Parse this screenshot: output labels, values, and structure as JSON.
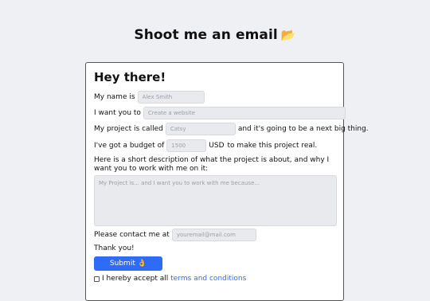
{
  "page": {
    "title": "Shoot me an email",
    "title_emoji": "📂"
  },
  "form": {
    "heading": "Hey there!",
    "name_label": "My name is",
    "name_placeholder": "Alex Smith",
    "want_label": "I want you to",
    "want_placeholder": "Create a website",
    "project_label": "My project is called",
    "project_placeholder": "Catsy",
    "project_suffix": "and it's going to be a next big thing.",
    "budget_label": "I've got a budget of",
    "budget_placeholder": "1500",
    "budget_currency": "USD",
    "budget_suffix": "to make this project real.",
    "description_label": "Here is a short description of what the project is about, and why I want you to work with me on it:",
    "description_placeholder": "My Project is... and I want you to work with me because...",
    "contact_label": "Please contact me at",
    "contact_placeholder": "youremail@mail.com",
    "thanks": "Thank you!",
    "submit_label": "Submit",
    "submit_emoji": "👌",
    "terms_prefix": "I hereby accept all",
    "terms_link": "terms and conditions",
    "terms_checked": false
  },
  "colors": {
    "accent": "#2f6cf6",
    "background": "#eef0f3",
    "input_bg": "#e8eaed"
  }
}
